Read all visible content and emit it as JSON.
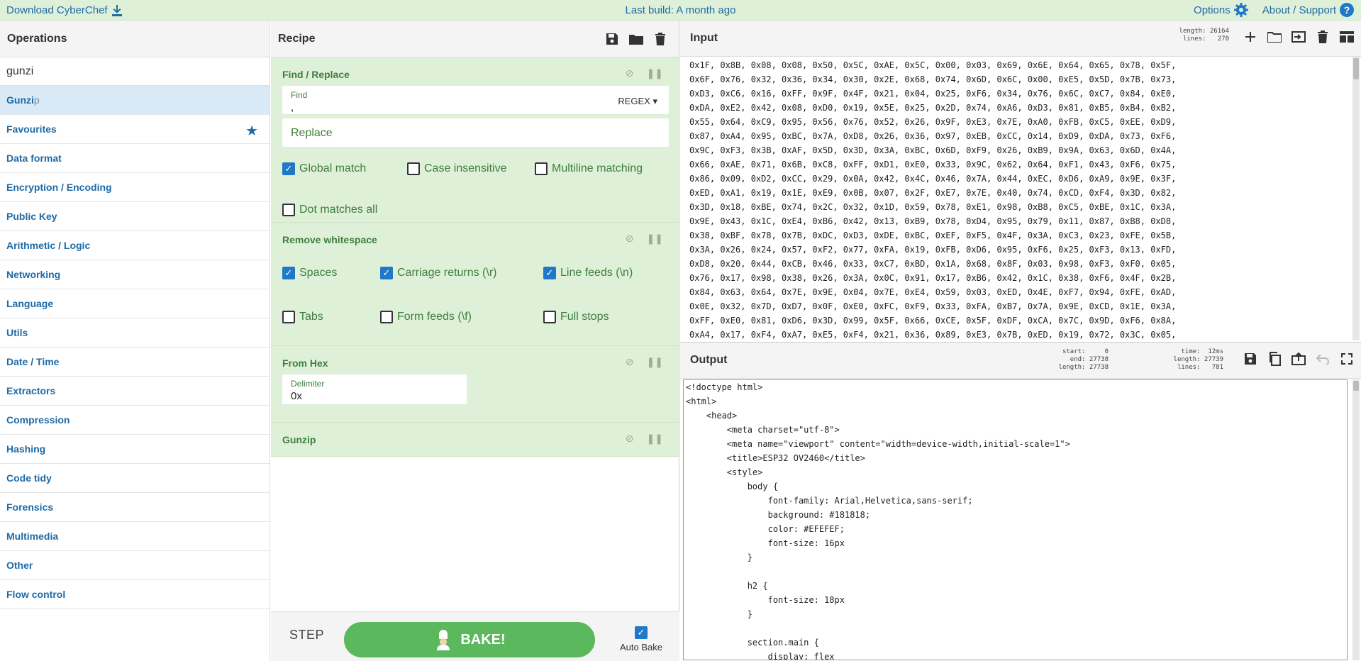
{
  "banner": {
    "download": "Download CyberChef",
    "build": "Last build: A month ago",
    "options": "Options",
    "about": "About / Support"
  },
  "operations": {
    "title": "Operations",
    "search_value": "gunzi",
    "result_match": "Gunzi",
    "result_rest": "p",
    "categories": [
      "Favourites",
      "Data format",
      "Encryption / Encoding",
      "Public Key",
      "Arithmetic / Logic",
      "Networking",
      "Language",
      "Utils",
      "Date / Time",
      "Extractors",
      "Compression",
      "Hashing",
      "Code tidy",
      "Forensics",
      "Multimedia",
      "Other",
      "Flow control"
    ]
  },
  "recipe": {
    "title": "Recipe",
    "find_replace": {
      "title": "Find / Replace",
      "find_label": "Find",
      "find_value": ",",
      "find_mode": "REGEX",
      "replace_placeholder": "Replace",
      "checks": [
        {
          "label": "Global match",
          "checked": true
        },
        {
          "label": "Case insensitive",
          "checked": false
        },
        {
          "label": "Multiline matching",
          "checked": false
        },
        {
          "label": "Dot matches all",
          "checked": false
        }
      ]
    },
    "remove_ws": {
      "title": "Remove whitespace",
      "checks": [
        {
          "label": "Spaces",
          "checked": true
        },
        {
          "label": "Carriage returns (\\r)",
          "checked": true
        },
        {
          "label": "Line feeds (\\n)",
          "checked": true
        },
        {
          "label": "Tabs",
          "checked": false
        },
        {
          "label": "Form feeds (\\f)",
          "checked": false
        },
        {
          "label": "Full stops",
          "checked": false
        }
      ]
    },
    "from_hex": {
      "title": "From Hex",
      "delimiter_label": "Delimiter",
      "delimiter_value": "0x"
    },
    "gunzip": {
      "title": "Gunzip"
    },
    "step": "STEP",
    "bake": "BAKE!",
    "auto_bake": "Auto Bake",
    "auto_bake_checked": true
  },
  "input": {
    "title": "Input",
    "stats": "length: 26164\n lines:   270",
    "lines": [
      "0x1F, 0x8B, 0x08, 0x08, 0x50, 0x5C, 0xAE, 0x5C, 0x00, 0x03, 0x69, 0x6E, 0x64, 0x65, 0x78, 0x5F,",
      "0x6F, 0x76, 0x32, 0x36, 0x34, 0x30, 0x2E, 0x68, 0x74, 0x6D, 0x6C, 0x00, 0xE5, 0x5D, 0x7B, 0x73,",
      "0xD3, 0xC6, 0x16, 0xFF, 0x9F, 0x4F, 0x21, 0x04, 0x25, 0xF6, 0x34, 0x76, 0x6C, 0xC7, 0x84, 0xE0,",
      "0xDA, 0xE2, 0x42, 0x08, 0xD0, 0x19, 0x5E, 0x25, 0x2D, 0x74, 0xA6, 0xD3, 0x81, 0xB5, 0xB4, 0xB2,",
      "0x55, 0x64, 0xC9, 0x95, 0x56, 0x76, 0x52, 0x26, 0x9F, 0xE3, 0x7E, 0xA0, 0xFB, 0xC5, 0xEE, 0xD9,",
      "0x87, 0xA4, 0x95, 0xBC, 0x7A, 0xD8, 0x26, 0x36, 0x97, 0xEB, 0xCC, 0x14, 0xD9, 0xDA, 0x73, 0xF6,",
      "0x9C, 0xF3, 0x3B, 0xAF, 0x5D, 0x3D, 0x3A, 0xBC, 0x6D, 0xF9, 0x26, 0xB9, 0x9A, 0x63, 0x6D, 0x4A,",
      "0x66, 0xAE, 0x71, 0x6B, 0xC8, 0xFF, 0xD1, 0xE0, 0x33, 0x9C, 0x62, 0x64, 0xF1, 0x43, 0xF6, 0x75,",
      "0x86, 0x09, 0xD2, 0xCC, 0x29, 0x0A, 0x42, 0x4C, 0x46, 0x7A, 0x44, 0xEC, 0xD6, 0xA9, 0x9E, 0x3F,",
      "0xED, 0xA1, 0x19, 0x1E, 0xE9, 0x0B, 0x07, 0x2F, 0xE7, 0x7E, 0x40, 0x74, 0xCD, 0xF4, 0x3D, 0x82,",
      "0x3D, 0x18, 0xBE, 0x74, 0x2C, 0x32, 0x1D, 0x59, 0x78, 0xE1, 0x98, 0xB8, 0xC5, 0xBE, 0x1C, 0x3A,",
      "0x9E, 0x43, 0x1C, 0xE4, 0xB6, 0x42, 0x13, 0xB9, 0x78, 0xD4, 0x95, 0x79, 0x11, 0x87, 0xB8, 0xD8,",
      "0x38, 0xBF, 0x78, 0x7B, 0xDC, 0xD3, 0xDE, 0xBC, 0xEF, 0xF5, 0x4F, 0x3A, 0xC3, 0x23, 0xFE, 0x5B,",
      "0x3A, 0x26, 0x24, 0x57, 0xF2, 0x77, 0xFA, 0x19, 0xFB, 0xD6, 0x95, 0xF6, 0x25, 0xF3, 0x13, 0xFD,",
      "0xD8, 0x20, 0x44, 0xCB, 0x46, 0x33, 0xC7, 0xBD, 0x1A, 0x68, 0x8F, 0x03, 0x98, 0xF3, 0xF0, 0x05,",
      "0x76, 0x17, 0x98, 0x38, 0x26, 0x3A, 0x0C, 0x91, 0x17, 0xB6, 0x42, 0x1C, 0x38, 0xF6, 0x4F, 0x2B,",
      "0x84, 0x63, 0x64, 0x7E, 0x9E, 0x04, 0x7E, 0xE4, 0x59, 0x03, 0xED, 0x4E, 0xF7, 0x94, 0xFE, 0xAD,",
      "0x0E, 0x32, 0x7D, 0xD7, 0x0F, 0xE0, 0xFC, 0xF9, 0x33, 0xFA, 0xB7, 0x7A, 0x9E, 0xCD, 0x1E, 0x3A,",
      "0xFF, 0xE0, 0x81, 0xD6, 0x3D, 0x99, 0x5F, 0x66, 0xCE, 0x5F, 0xDF, 0xCA, 0x7C, 0x9D, 0xF6, 0x8A,",
      "0xA4, 0x17, 0xF4, 0xA7, 0xE5, 0xF4, 0x21, 0x36, 0x89, 0xE3, 0x7B, 0xED, 0x19, 0x72, 0x3C, 0x05,"
    ]
  },
  "output": {
    "title": "Output",
    "stats_a": "start:     0\n  end: 27738\nlength: 27738",
    "stats_b": " time:  12ms\nlength: 27739\n lines:   781",
    "lines": [
      "<!doctype html>",
      "<html>",
      "    <head>",
      "        <meta charset=\"utf-8\">",
      "        <meta name=\"viewport\" content=\"width=device-width,initial-scale=1\">",
      "        <title>ESP32 OV2460</title>",
      "        <style>",
      "            body {",
      "                font-family: Arial,Helvetica,sans-serif;",
      "                background: #181818;",
      "                color: #EFEFEF;",
      "                font-size: 16px",
      "            }",
      "",
      "            h2 {",
      "                font-size: 18px",
      "            }",
      "",
      "            section.main {",
      "                display: flex"
    ]
  }
}
